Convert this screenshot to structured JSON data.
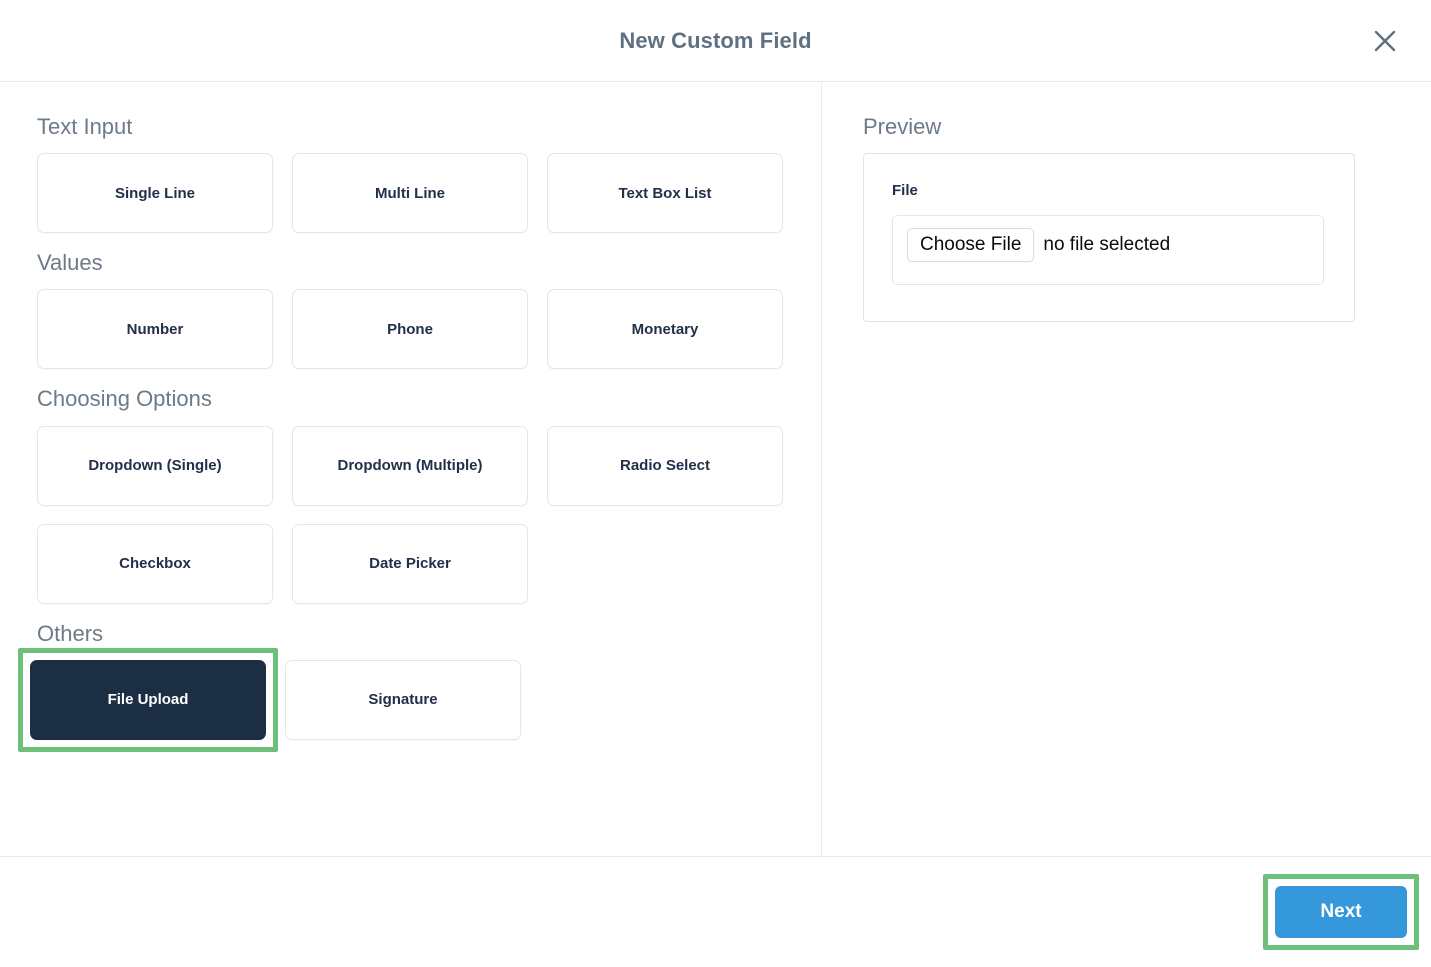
{
  "header": {
    "title": "New Custom Field",
    "close_icon": "close-icon"
  },
  "left_pane": {
    "sections": [
      {
        "title": "Text Input",
        "options": [
          {
            "label": "Single Line",
            "selected": false
          },
          {
            "label": "Multi Line",
            "selected": false
          },
          {
            "label": "Text Box List",
            "selected": false
          }
        ]
      },
      {
        "title": "Values",
        "options": [
          {
            "label": "Number",
            "selected": false
          },
          {
            "label": "Phone",
            "selected": false
          },
          {
            "label": "Monetary",
            "selected": false
          }
        ]
      },
      {
        "title": "Choosing Options",
        "options": [
          {
            "label": "Dropdown (Single)",
            "selected": false
          },
          {
            "label": "Dropdown (Multiple)",
            "selected": false
          },
          {
            "label": "Radio Select",
            "selected": false
          },
          {
            "label": "Checkbox",
            "selected": false
          },
          {
            "label": "Date Picker",
            "selected": false
          }
        ]
      },
      {
        "title": "Others",
        "options": [
          {
            "label": "File Upload",
            "selected": true,
            "highlighted": true
          },
          {
            "label": "Signature",
            "selected": false
          }
        ]
      }
    ]
  },
  "right_pane": {
    "title": "Preview",
    "field_label": "File",
    "choose_file_label": "Choose File",
    "file_status": "no file selected"
  },
  "footer": {
    "next_label": "Next",
    "next_highlighted": true
  },
  "colors": {
    "accent_blue": "#3498db",
    "selected_navy": "#1c2e44",
    "highlight_green": "#6cc07a",
    "title_gray": "#5e7183",
    "section_gray": "#6d7a87",
    "border_light": "#e3e7ec"
  }
}
